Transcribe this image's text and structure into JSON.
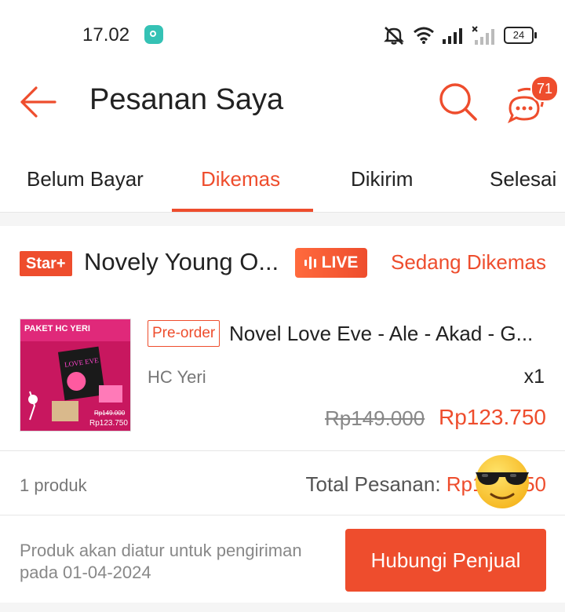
{
  "status_bar": {
    "time": "17.02",
    "battery": "24"
  },
  "header": {
    "title": "Pesanan Saya",
    "chat_badge": "71"
  },
  "tabs": [
    {
      "label": "Belum Bayar",
      "active": false
    },
    {
      "label": "Dikemas",
      "active": true
    },
    {
      "label": "Dikirim",
      "active": false
    },
    {
      "label": "Selesai",
      "active": false
    }
  ],
  "order": {
    "shop_badge": "Star+",
    "shop_name": "Novely Young O...",
    "live_label": "LIVE",
    "status": "Sedang Dikemas",
    "product": {
      "image_title": "PAKET HC YERI",
      "image_book_title": "LOVE EVE",
      "image_old_price": "Rp149.000",
      "image_new_price": "Rp123.750",
      "tag": "Pre-order",
      "name": "Novel Love Eve - Ale - Akad - G...",
      "variant": "HC Yeri",
      "quantity": "x1",
      "original_price": "Rp149.000",
      "price": "Rp123.750"
    },
    "product_count": "1 produk",
    "total_label": "Total Pesanan: ",
    "total_value": "Rp123.750",
    "shipping_note": "Produk akan diatur untuk pengiriman pada 01-04-2024",
    "contact_button": "Hubungi Penjual"
  },
  "colors": {
    "accent": "#ee4d2d",
    "tab_active": "#ee4d2d"
  },
  "icons": [
    "back-arrow-icon",
    "search-icon",
    "chat-icon",
    "mute-icon",
    "wifi-icon",
    "signal-icon",
    "battery-icon",
    "sunglasses-emoji-icon"
  ]
}
